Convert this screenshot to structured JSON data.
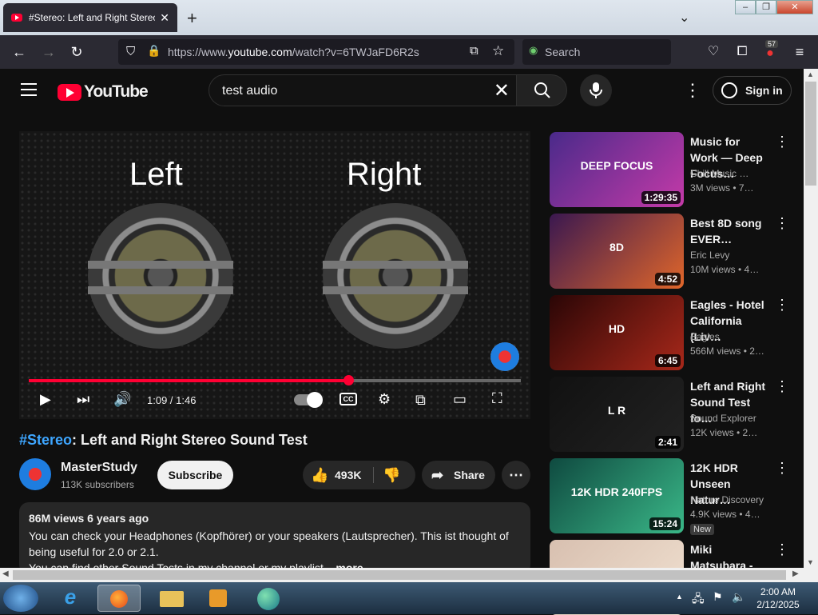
{
  "browser": {
    "tab_title": "#Stereo: Left and Right Stereo S",
    "url_prefix": "https://www.",
    "url_domain": "youtube.com",
    "url_path": "/watch?v=6TWJaFD6R2s",
    "search_placeholder": "Search",
    "extension_badge": "57"
  },
  "youtube": {
    "logo_text": "YouTube",
    "search_query": "test audio",
    "sign_in_label": "Sign in"
  },
  "player": {
    "left_label": "Left",
    "right_label": "Right",
    "time": "1:09 / 1:46",
    "progress_fraction": 0.65,
    "cc_label": "CC"
  },
  "video": {
    "title_hashtag": "#Stereo",
    "title_rest": ": Left and Right Stereo Sound Test",
    "channel_name": "MasterStudy",
    "subscribers": "113K subscribers",
    "subscribe_label": "Subscribe",
    "likes": "493K",
    "share_label": "Share",
    "stats": "86M views  6 years ago",
    "description_line1": "You can check your Headphones (Kopfhörer) or your speakers (Lautsprecher). This ist thought of",
    "description_line2": "being useful for 2.0 or 2.1.",
    "description_line3": "You can find other Sound Tests in my channel or my playlist",
    "more_label": "...more"
  },
  "recommendations": [
    {
      "title": "Music for Work — Deep Focus…",
      "channel": "Chill Music …",
      "views": "3M views  • 7…",
      "duration": "1:29:35",
      "overlay": "DEEP FOCUS",
      "colors": [
        "#4a2a8a",
        "#c43aa8"
      ]
    },
    {
      "title": "Best 8D song EVER…",
      "channel": "Eric Levy",
      "views": "10M views  • 4…",
      "duration": "4:52",
      "overlay": "8D",
      "colors": [
        "#3a1850",
        "#e0662a"
      ]
    },
    {
      "title": "Eagles - Hotel California (Liv…",
      "channel": "Eagles",
      "views": "566M views  • 2…",
      "duration": "6:45",
      "overlay": "HD",
      "colors": [
        "#2a0606",
        "#a8281a"
      ]
    },
    {
      "title": "Left and Right Sound Test fo…",
      "channel": "Sound Explorer",
      "views": "12K views  • 2…",
      "duration": "2:41",
      "overlay": "L   R",
      "colors": [
        "#111111",
        "#222222"
      ]
    },
    {
      "title": "12K HDR Unseen Natur…",
      "channel": "Nature Discovery",
      "views": "4.9K views  • 4…",
      "duration": "15:24",
      "overlay": "12K HDR 240FPS",
      "badge": "New",
      "colors": [
        "#0f4a40",
        "#3ab888"
      ]
    },
    {
      "title": "Miki Matsubara - Stay With M…",
      "channel": "",
      "views": "",
      "duration": "",
      "overlay": "",
      "colors": [
        "#d8c0b0",
        "#f0e0d0"
      ]
    }
  ],
  "taskbar": {
    "time": "2:00 AM",
    "date": "2/12/2025"
  }
}
